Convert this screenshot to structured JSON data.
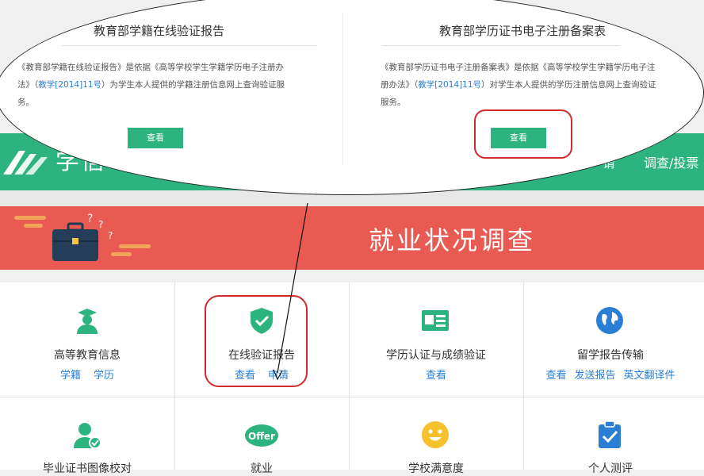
{
  "header": {
    "title": "学信",
    "link_partial": "请",
    "survey_link": "调查/投票"
  },
  "banner": {
    "title": "就业状况调查"
  },
  "services": [
    {
      "title": "高等教育信息",
      "links": [
        "学籍",
        "学历"
      ],
      "icon": "graduate-icon"
    },
    {
      "title": "在线验证报告",
      "links": [
        "查看",
        "申请"
      ],
      "icon": "shield-check-icon"
    },
    {
      "title": "学历认证与成绩验证",
      "links": [
        "查看"
      ],
      "icon": "id-card-icon"
    },
    {
      "title": "留学报告传输",
      "links": [
        "查看",
        "发送报告",
        "英文翻译件"
      ],
      "icon": "globe-icon"
    },
    {
      "title": "毕业证书图像校对",
      "links": [],
      "icon": "user-check-icon"
    },
    {
      "title": "就业",
      "links": [],
      "icon": "offer-icon"
    },
    {
      "title": "学校满意度",
      "links": [],
      "icon": "smiley-icon"
    },
    {
      "title": "个人测评",
      "links": [],
      "icon": "clipboard-check-icon"
    }
  ],
  "popup": {
    "left": {
      "title": "教育部学籍在线验证报告",
      "desc_lines": [
        {
          "pre": "《教育部学籍在线验证报告》是依据《高等学校学生学籍学历电子注册办"
        },
        {
          "pre": "法》（",
          "link": "教学[2014]11号",
          "post": "）为学生本人提供的学籍注册信息网上查询验证服"
        },
        {
          "pre": "务。"
        }
      ],
      "button": "查看"
    },
    "right": {
      "title": "教育部学历证书电子注册备案表",
      "desc_lines": [
        {
          "pre": "《教育部学历证书电子注册备案表》是依据《高等学校学生学籍学历电子注"
        },
        {
          "pre": "册办法》（",
          "link": "教学[2014]11号",
          "post": "）对学生本人提供的学历注册信息网上查询验证"
        },
        {
          "pre": "服务。"
        }
      ],
      "button": "查看"
    }
  },
  "colors": {
    "brand_green": "#2db380",
    "banner_red": "#e85a52",
    "link_blue": "#2a7fd4",
    "highlight_red": "#d22a2a"
  }
}
